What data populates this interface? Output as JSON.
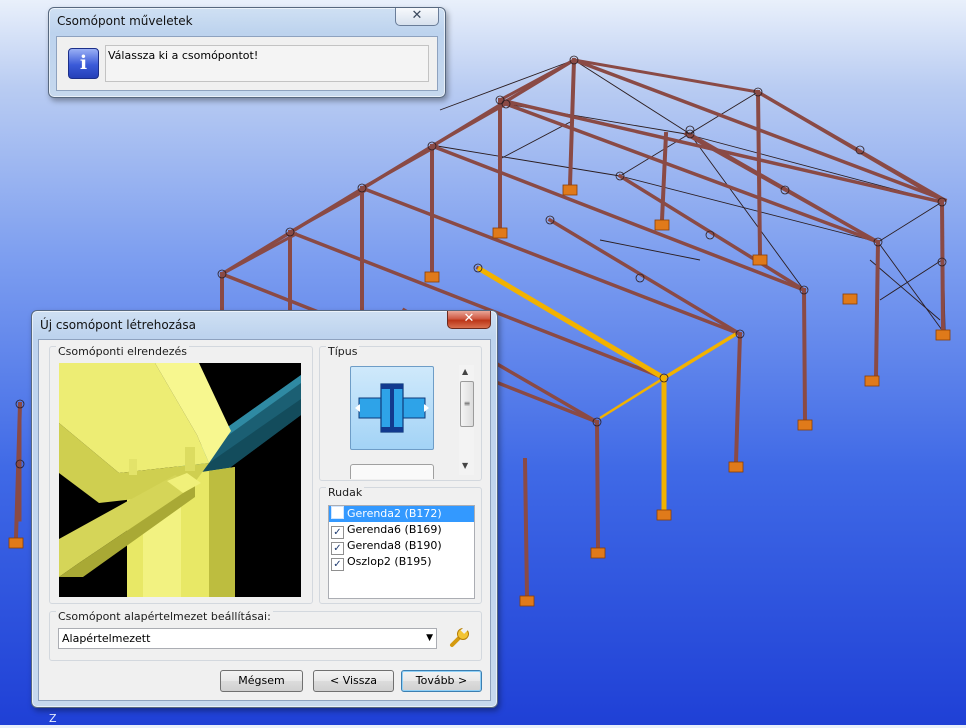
{
  "viewport": {
    "label": "3D structural model view",
    "axis_z_label": "Z",
    "colors": {
      "frame": "#8a4a45",
      "highlight": "#f2b200",
      "support": "#e07a1a",
      "bracing": "#2b1d20"
    }
  },
  "message_dialog": {
    "title": "Csomópont műveletek",
    "icon": "info-icon",
    "message": "Válassza ki a csomópontot!",
    "close_label": "✕"
  },
  "connection_dialog": {
    "title": "Új csomópont létrehozása",
    "close_label": "✕",
    "layout_group": {
      "label": "Csomóponti elrendezés"
    },
    "type_group": {
      "label": "Típus",
      "selected_type_icon": "beam-to-column-joint-icon"
    },
    "members_group": {
      "label": "Rudak",
      "items": [
        {
          "label": "Gerenda2 (B172)",
          "checked": false,
          "selected": true
        },
        {
          "label": "Gerenda6 (B169)",
          "checked": true,
          "selected": false
        },
        {
          "label": "Gerenda8 (B190)",
          "checked": true,
          "selected": false
        },
        {
          "label": "Oszlop2 (B195)",
          "checked": true,
          "selected": false
        }
      ]
    },
    "defaults_group": {
      "label": "Csomópont alapértelmezet beállításai:",
      "selected": "Alapértelmezett",
      "settings_icon": "wrench-icon"
    },
    "buttons": {
      "cancel": "Mégsem",
      "back": "< Vissza",
      "next": "Tovább >"
    }
  }
}
